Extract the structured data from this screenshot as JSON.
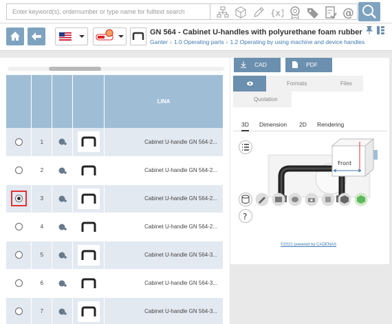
{
  "search": {
    "placeholder": "Enter keyword(s), ordernumber or type name for fulltext search"
  },
  "toolbar": {
    "icons": [
      "hierarchy-icon",
      "cube-icon",
      "pencil-icon",
      "variable-icon",
      "seal-icon",
      "tag-icon",
      "checklist-icon",
      "at-icon",
      "search-icon"
    ]
  },
  "header": {
    "title": "GN 564 - Cabinet U-handles with polyurethane foam rubber",
    "breadcrumb": [
      "Ganter",
      "1.0 Operating parts",
      "1.2 Operating by using machine and device handles"
    ],
    "language_flag": "us-flag-icon",
    "catalog_logo": "ganter-logo-icon"
  },
  "table": {
    "column_header": "LINA",
    "rows": [
      {
        "num": "1",
        "desc": "Cabinet U-handle GN 564-2...",
        "selected": false
      },
      {
        "num": "2",
        "desc": "Cabinet U-handle GN 564-2...",
        "selected": false
      },
      {
        "num": "3",
        "desc": "Cabinet U-handle GN 564-2...",
        "selected": true
      },
      {
        "num": "4",
        "desc": "Cabinet U-handle GN 564-2...",
        "selected": false
      },
      {
        "num": "5",
        "desc": "Cabinet U-handle GN 564-3...",
        "selected": false
      },
      {
        "num": "6",
        "desc": "Cabinet U-handle GN 564-3...",
        "selected": false
      },
      {
        "num": "7",
        "desc": "Cabinet U-handle GN 564-3...",
        "selected": false
      }
    ]
  },
  "right_panel": {
    "cad_label": "CAD",
    "pdf_label": "PDF",
    "formats_label": "Formats",
    "files_label": "Files",
    "quotation_label": "Quotation",
    "subtabs": [
      "3D",
      "Dimension",
      "2D",
      "Rendering"
    ],
    "active_subtab": "3D",
    "viewcube_label": "Front",
    "footer_link": "©2021 powered by CADENAS"
  },
  "colors": {
    "accent": "#7ea3c0",
    "header_blue": "#9fbed6",
    "row_alt": "#e2e9f1",
    "link": "#3d7ab3",
    "selection": "#e23030"
  }
}
